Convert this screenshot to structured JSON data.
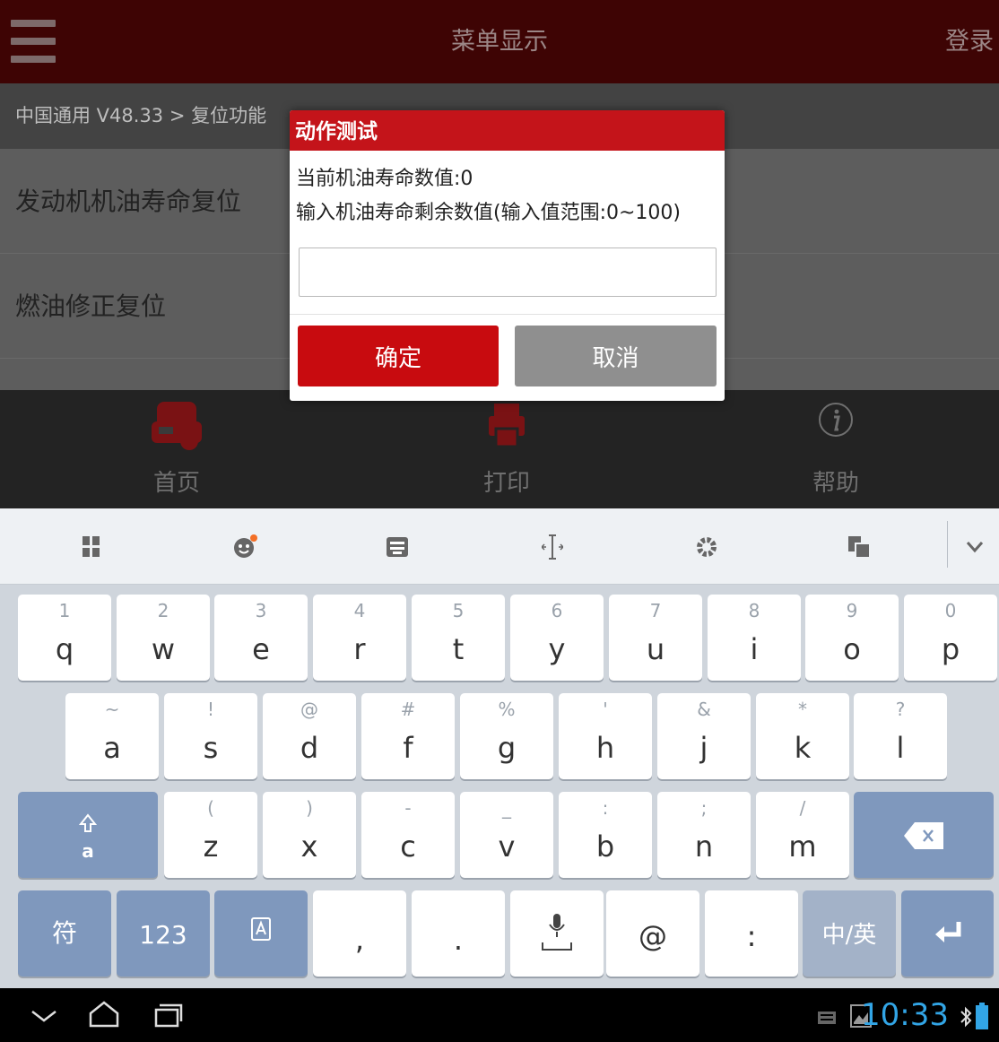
{
  "header": {
    "title": "菜单显示",
    "login_label": "登录"
  },
  "breadcrumb": "中国通用 V48.33 > 复位功能",
  "list": [
    {
      "label": "发动机机油寿命复位"
    },
    {
      "label": "燃油修正复位"
    }
  ],
  "bottom_nav": [
    {
      "label": "首页",
      "icon": "car-icon"
    },
    {
      "label": "打印",
      "icon": "printer-icon"
    },
    {
      "label": "帮助",
      "icon": "info-icon"
    }
  ],
  "dialog": {
    "title": "动作测试",
    "line1": "当前机油寿命数值:0",
    "line2": "输入机油寿命剩余数值(输入值范围:0~100)",
    "input_value": "",
    "ok_label": "确定",
    "cancel_label": "取消"
  },
  "keyboard": {
    "toolbar_icons": [
      "grid-icon",
      "emoji-icon",
      "keyboard-icon",
      "cursor-icon",
      "gear-icon",
      "clipboard-icon",
      "collapse-icon"
    ],
    "row1": [
      {
        "key": "q",
        "sub": "1"
      },
      {
        "key": "w",
        "sub": "2"
      },
      {
        "key": "e",
        "sub": "3"
      },
      {
        "key": "r",
        "sub": "4"
      },
      {
        "key": "t",
        "sub": "5"
      },
      {
        "key": "y",
        "sub": "6"
      },
      {
        "key": "u",
        "sub": "7"
      },
      {
        "key": "i",
        "sub": "8"
      },
      {
        "key": "o",
        "sub": "9"
      },
      {
        "key": "p",
        "sub": "0"
      }
    ],
    "row2": [
      {
        "key": "a",
        "sub": "~"
      },
      {
        "key": "s",
        "sub": "!"
      },
      {
        "key": "d",
        "sub": "@"
      },
      {
        "key": "f",
        "sub": "#"
      },
      {
        "key": "g",
        "sub": "%"
      },
      {
        "key": "h",
        "sub": "'"
      },
      {
        "key": "j",
        "sub": "&"
      },
      {
        "key": "k",
        "sub": "*"
      },
      {
        "key": "l",
        "sub": "?"
      }
    ],
    "row3": [
      {
        "key": "z",
        "sub": "("
      },
      {
        "key": "x",
        "sub": ")"
      },
      {
        "key": "c",
        "sub": "-"
      },
      {
        "key": "v",
        "sub": "_"
      },
      {
        "key": "b",
        "sub": ":"
      },
      {
        "key": "n",
        "sub": ";"
      },
      {
        "key": "m",
        "sub": "/"
      }
    ],
    "shift_label": "a",
    "symbol_label": "符",
    "num_label": "123",
    "comma_label": ",",
    "period_label": ".",
    "at_label": "@",
    "colon_label": ":",
    "lang_label": "中/英"
  },
  "system_bar": {
    "time": "10:33"
  }
}
